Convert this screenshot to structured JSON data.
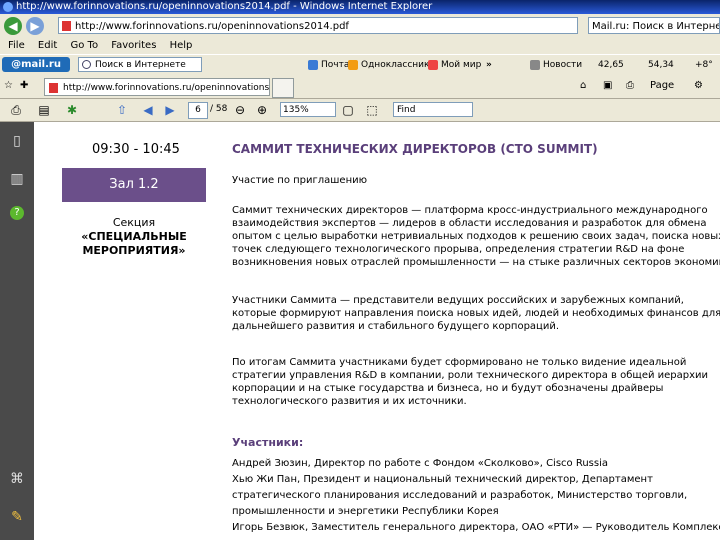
{
  "window": {
    "title": "http://www.forinnovations.ru/openinnovations2014.pdf - Windows Internet Explorer",
    "address": "http://www.forinnovations.ru/openinnovations2014.pdf",
    "search_text": "Mail.ru: Поиск в Интернете"
  },
  "menu": [
    "File",
    "Edit",
    "Go To",
    "Favorites",
    "Help"
  ],
  "mail_toolbar": {
    "logo": "@mail.ru",
    "search_placeholder": "Поиск в Интернете",
    "items": [
      "Почта",
      "Одноклассники",
      "Мой мир",
      "»",
      "Новости",
      "42,65",
      "54,34",
      "+8°"
    ]
  },
  "tab": {
    "label": "http://www.forinnovations.ru/openinnovations2014.pdf",
    "page_menu": "Page",
    "home_label": "Home"
  },
  "pdf_toolbar": {
    "page_current": "6",
    "page_total": "/ 58",
    "zoom": "135%",
    "find_placeholder": "Find"
  },
  "document": {
    "time": "09:30 - 10:45",
    "hall": "Зал 1.2",
    "section_label": "Секция",
    "section_name": "«СПЕЦИАЛЬНЫЕ МЕРОПРИЯТИЯ»",
    "title": "САММИТ ТЕХНИЧЕСКИХ ДИРЕКТОРОВ (CTO SUMMIT)",
    "invite": "Участие по приглашению",
    "para1": [
      "Саммит технических директоров — платформа кросс-индустриального международного",
      "взаимодействия экспертов — лидеров в области исследования и разработок для обмена",
      "опытом с целью выработки нетривиальных подходов к решению своих задач, поиска новых",
      "точек следующего технологического прорыва, определения стратегии R&D на фоне",
      "возникновения новых отраслей промышленности — на стыке различных секторов экономики."
    ],
    "para2": [
      "Участники Саммита — представители ведущих российских и зарубежных компаний,",
      "которые формируют направления поиска новых идей, людей и необходимых финансов для",
      "дальнейшего развития и стабильного будущего корпораций."
    ],
    "para3": [
      "По итогам Саммита участниками будет сформировано не только видение идеальной",
      "стратегии управления R&D в компании, роли технического директора в общей иерархии",
      "корпорации и на стыке государства и бизнеса, но и будут обозначены драйверы",
      "технологического развития и их источники."
    ],
    "participants_heading": "Участники:",
    "participants": [
      "Андрей Зюзин, Директор по работе с Фондом «Сколково», Cisco Russia",
      "Хью Жи Пан, Президент и национальный технический директор, Департамент",
      "стратегического планирования исследований и разработок, Министерство торговли,",
      "промышленности и энергетики Республики Корея",
      "Игорь Безвюк, Заместитель генерального директора, ОАО «РТИ» — Руководитель Комплекса"
    ]
  }
}
